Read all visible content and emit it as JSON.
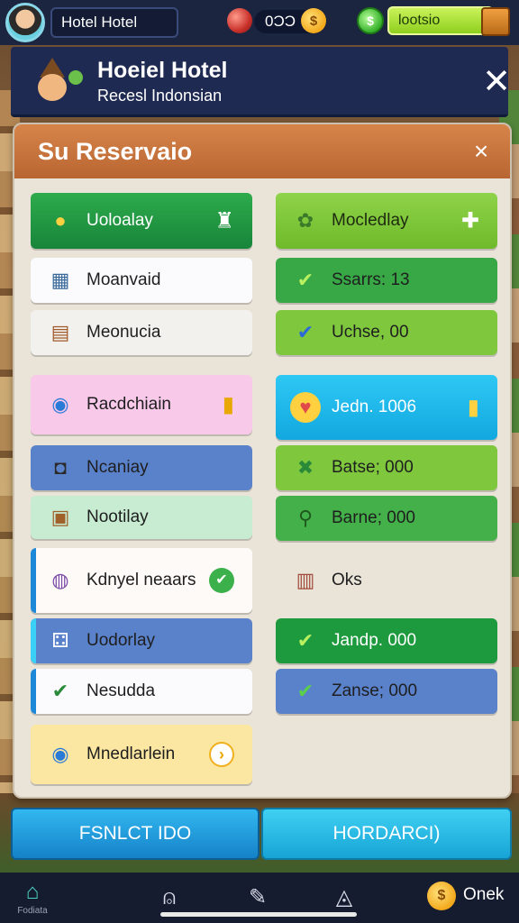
{
  "hud": {
    "player_name": "Hotel Hotel",
    "coins_value": "0ƆƆ",
    "coin_symbol": "$",
    "gem_symbol": "$",
    "green_pill_label": "lootsio"
  },
  "banner": {
    "title": "Hoeiel Hotel",
    "subtitle": "Recesl Indonsian",
    "close_symbol": "✕"
  },
  "panel": {
    "title": "Su Reservaio",
    "close_symbol": "×"
  },
  "left_column": [
    {
      "label": "Uoloalay",
      "icon": "trophy-icon",
      "icon_glyph": "●",
      "trail": "♜"
    },
    {
      "label": "Moanvaid",
      "icon": "calendar-icon",
      "icon_glyph": "▦",
      "trail": ""
    },
    {
      "label": "Meonucia",
      "icon": "clipboard-icon",
      "icon_glyph": "▤",
      "trail": ""
    },
    {
      "label": "Racdchiain",
      "icon": "compass-icon",
      "icon_glyph": "◉",
      "trail": "▮"
    },
    {
      "label": "Ncaniay",
      "icon": "camera-icon",
      "icon_glyph": "◘",
      "trail": ""
    },
    {
      "label": "Nootilay",
      "icon": "suitcase-icon",
      "icon_glyph": "▣",
      "trail": ""
    },
    {
      "label": "Kdnyel neaars",
      "icon": "bag-icon",
      "icon_glyph": "◍",
      "trail": "✔"
    },
    {
      "label": "Uodorlay",
      "icon": "dice-icon",
      "icon_glyph": "⚃",
      "trail": ""
    },
    {
      "label": "Nesudda",
      "icon": "check-box-icon",
      "icon_glyph": "✔",
      "trail": ""
    },
    {
      "label": "Mnedlarlein",
      "icon": "compass-icon",
      "icon_glyph": "◉",
      "trail": "›"
    }
  ],
  "right_column": [
    {
      "label": "Mocledlay",
      "icon": "flowers-icon",
      "icon_glyph": "✿",
      "trail": "✚"
    },
    {
      "label": "Ssarrs: 13",
      "icon": "check-icon",
      "icon_glyph": "✔",
      "trail": ""
    },
    {
      "label": "Uchse, 00",
      "icon": "check-box-icon",
      "icon_glyph": "✔",
      "trail": ""
    },
    {
      "label": "Jedn. 1006",
      "icon": "heart-icon",
      "icon_glyph": "♥",
      "trail": "▮"
    },
    {
      "label": "Batse; 000",
      "icon": "star-icon",
      "icon_glyph": "✖",
      "trail": ""
    },
    {
      "label": "Barne; 000",
      "icon": "key-icon",
      "icon_glyph": "⚲",
      "trail": ""
    },
    {
      "label": "Oks",
      "icon": "notebook-icon",
      "icon_glyph": "▥",
      "trail": ""
    },
    {
      "label": "Jandp. 000",
      "icon": "check-icon",
      "icon_glyph": "✔",
      "trail": ""
    },
    {
      "label": "Zanse; 000",
      "icon": "check-icon",
      "icon_glyph": "✔",
      "trail": ""
    }
  ],
  "footer": {
    "left_button": "FSNLCT IDO",
    "right_button": "HORDARCI)"
  },
  "nav": {
    "items": [
      {
        "icon": "home-icon",
        "glyph": "⌂",
        "caption": "Fodiata"
      },
      {
        "icon": "lock-icon",
        "glyph": "⍝",
        "caption": ""
      },
      {
        "icon": "ticket-icon",
        "glyph": "✎",
        "caption": ""
      },
      {
        "icon": "compass-icon",
        "glyph": "◬",
        "caption": ""
      }
    ],
    "coin_symbol": "$",
    "coin_label": "Onek"
  },
  "colors": {
    "hud_bg": "#1c2540",
    "banner_bg": "#1f2a52",
    "panel_header": "#c97040",
    "panel_bg": "#e9e3d8",
    "green_dark": "#1f9a3e",
    "green_light": "#7cc83a",
    "blue_card": "#5c84cc",
    "cyan_card": "#18b8ec",
    "pink_card": "#f8c8e8",
    "mint_card": "#c6ecd0",
    "yellow_card": "#fbe6a0",
    "button_blue": "#1fa0e0"
  }
}
